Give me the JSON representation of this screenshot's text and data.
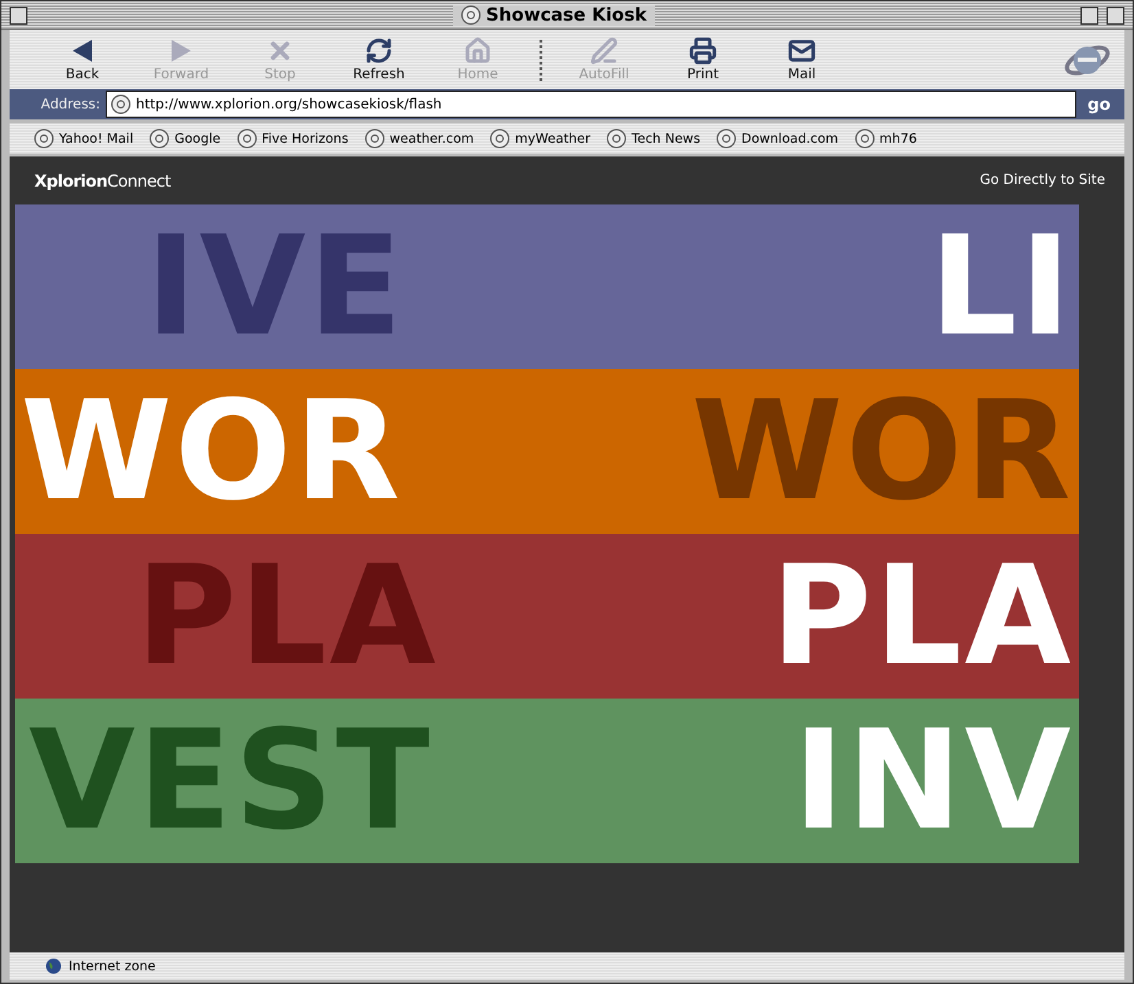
{
  "window": {
    "title": "Showcase Kiosk"
  },
  "toolbar": [
    {
      "label": "Back",
      "kind": "back",
      "disabled": false
    },
    {
      "label": "Forward",
      "kind": "forward",
      "disabled": true
    },
    {
      "label": "Stop",
      "kind": "stop",
      "disabled": true
    },
    {
      "label": "Refresh",
      "kind": "refresh",
      "disabled": false
    },
    {
      "label": "Home",
      "kind": "home",
      "disabled": true
    },
    {
      "label": "AutoFill",
      "kind": "autofill",
      "disabled": true
    },
    {
      "label": "Print",
      "kind": "print",
      "disabled": false
    },
    {
      "label": "Mail",
      "kind": "mail",
      "disabled": false
    }
  ],
  "address_bar": {
    "label": "Address:",
    "value": "http://www.xplorion.org/showcasekiosk/flash",
    "button": "go"
  },
  "favorites": [
    "Yahoo! Mail",
    "Google",
    "Five Horizons",
    "weather.com",
    "myWeather",
    "Tech News",
    "Download.com",
    "mh76"
  ],
  "page": {
    "logo": {
      "part_1": "Xplorion",
      "part_2": "Connect"
    },
    "link": "Go Directly to Site",
    "bands": [
      {
        "color": "#666699",
        "words": [
          {
            "text": "IVE",
            "color": "#35346a"
          },
          {
            "text": "LI",
            "color": "#ffffff"
          }
        ]
      },
      {
        "color": "#cc6600",
        "words": [
          {
            "text": "WOR",
            "color": "#ffffff"
          },
          {
            "text": "WOR",
            "color": "#773600"
          }
        ]
      },
      {
        "color": "#993333",
        "words": [
          {
            "text": "PLA",
            "color": "#661111"
          },
          {
            "text": "PLA",
            "color": "#ffffff"
          }
        ]
      },
      {
        "color": "#5f935f",
        "words": [
          {
            "text": "VEST",
            "color": "#1f511f"
          },
          {
            "text": "INV",
            "color": "#ffffff"
          }
        ]
      }
    ]
  },
  "status_bar": {
    "zone": "Internet zone"
  }
}
